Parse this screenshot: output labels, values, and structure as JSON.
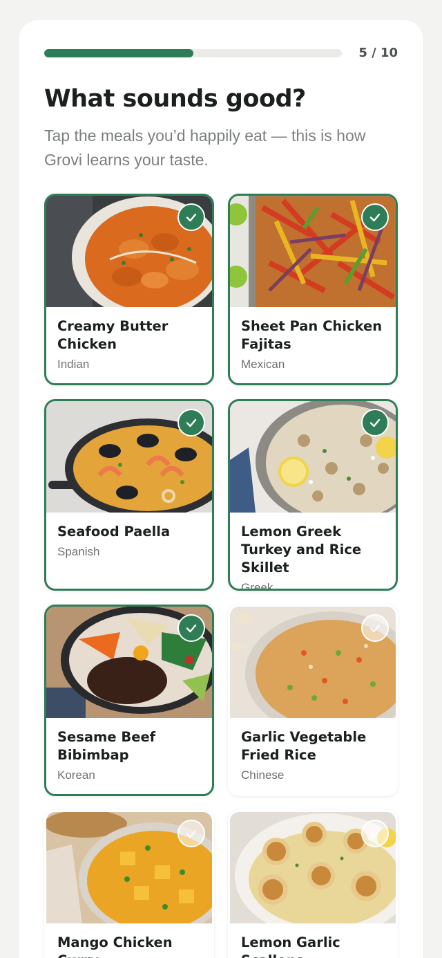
{
  "progress": {
    "current": 5,
    "total": 10,
    "label": "5 / 10",
    "fraction": 0.5
  },
  "header": {
    "title": "What sounds good?",
    "subtitle": "Tap the meals you’d happily eat — this is how Grovi learns your taste."
  },
  "colors": {
    "accent": "#2e7d57",
    "track": "#ebece8",
    "background": "#f3f3f1"
  },
  "meals": [
    {
      "name": "Creamy Butter Chicken",
      "cuisine": "Indian",
      "selected": true
    },
    {
      "name": "Sheet Pan Chicken Fajitas",
      "cuisine": "Mexican",
      "selected": true
    },
    {
      "name": "Seafood Paella",
      "cuisine": "Spanish",
      "selected": true
    },
    {
      "name": "Lemon Greek Turkey and Rice Skillet",
      "cuisine": "Greek",
      "selected": true
    },
    {
      "name": "Sesame Beef Bibimbap",
      "cuisine": "Korean",
      "selected": true
    },
    {
      "name": "Garlic Vegetable Fried Rice",
      "cuisine": "Chinese",
      "selected": false
    },
    {
      "name": "Mango Chicken Curry",
      "cuisine": "",
      "selected": false
    },
    {
      "name": "Lemon Garlic Scallops",
      "cuisine": "",
      "selected": false
    }
  ],
  "icons": {
    "check": "check-icon"
  }
}
